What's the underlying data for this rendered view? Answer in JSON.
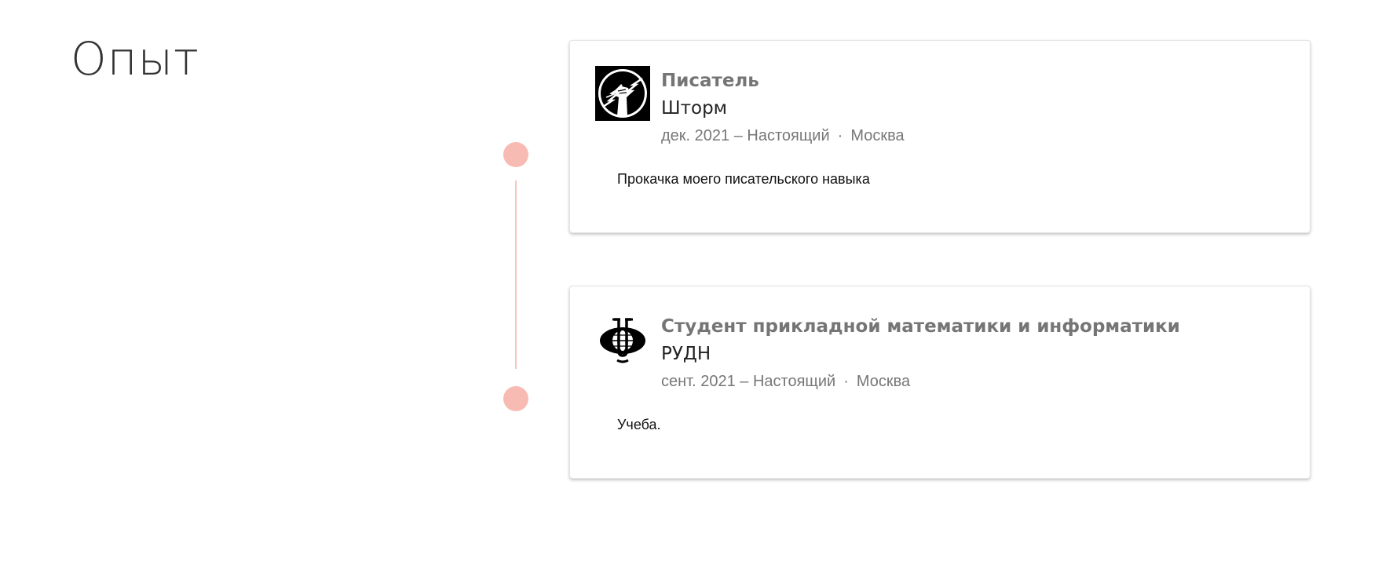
{
  "section": {
    "title": "Опыт"
  },
  "experience": [
    {
      "logo_icon": "storm-lightning-logo-icon",
      "title": "Писатель",
      "company": "Шторм",
      "period": "дек. 2021 – Настоящий",
      "separator": "·",
      "location": "Москва",
      "description": "Прокачка моего писательского навыка"
    },
    {
      "logo_icon": "rudn-globe-logo-icon",
      "title": "Студент прикладной математики и информатики",
      "company": "РУДН",
      "period": "сент. 2021 – Настоящий",
      "separator": "·",
      "location": "Москва",
      "description": "Учеба."
    }
  ],
  "colors": {
    "timeline": "#f6c6c0",
    "dot": "#f8bbb3",
    "title_gray": "#757575",
    "meta_gray": "#777777"
  }
}
